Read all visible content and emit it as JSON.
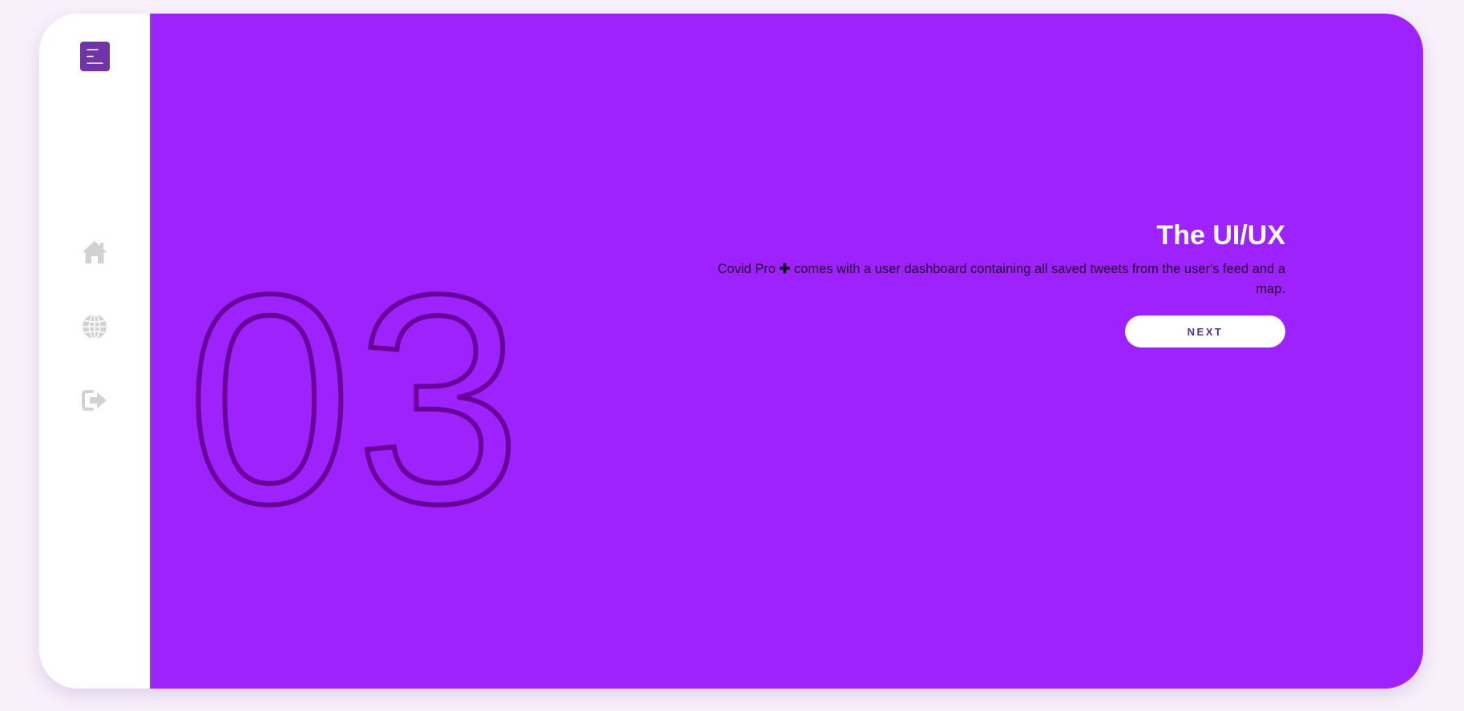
{
  "sidebar": {
    "menu_icon": "menu-lines-icon",
    "nav_icons": [
      "home-icon",
      "globe-icon",
      "sign-out-icon"
    ]
  },
  "hero": {
    "number": "03",
    "title": "The UI/UX",
    "desc_before": "Covid Pro",
    "plus_symbol": "✚",
    "desc_after": "comes with a user dashboard containing all saved tweets from the user's feed and a map.",
    "next_label": "NEXT"
  },
  "colors": {
    "page_background": "#f8f1fb",
    "card_background": "#ffffff",
    "main_panel": "#9d22fd",
    "big_number_outline": "#6a009a",
    "menu_button": "#6f35a5",
    "nav_icon": "#d2d2d2",
    "title_text": "#ffffff",
    "body_text": "#1f0c2b",
    "button_background": "#ffffff",
    "button_text": "#5a2e82"
  }
}
